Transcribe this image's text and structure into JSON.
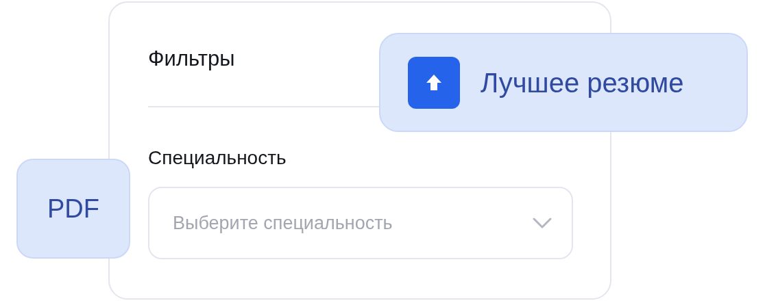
{
  "filters_card": {
    "title": "Фильтры",
    "field_label": "Специальность",
    "select": {
      "placeholder": "Выберите специальность"
    }
  },
  "best_resume_badge": {
    "label": "Лучшее резюме"
  },
  "pdf_badge": {
    "label": "PDF"
  }
}
